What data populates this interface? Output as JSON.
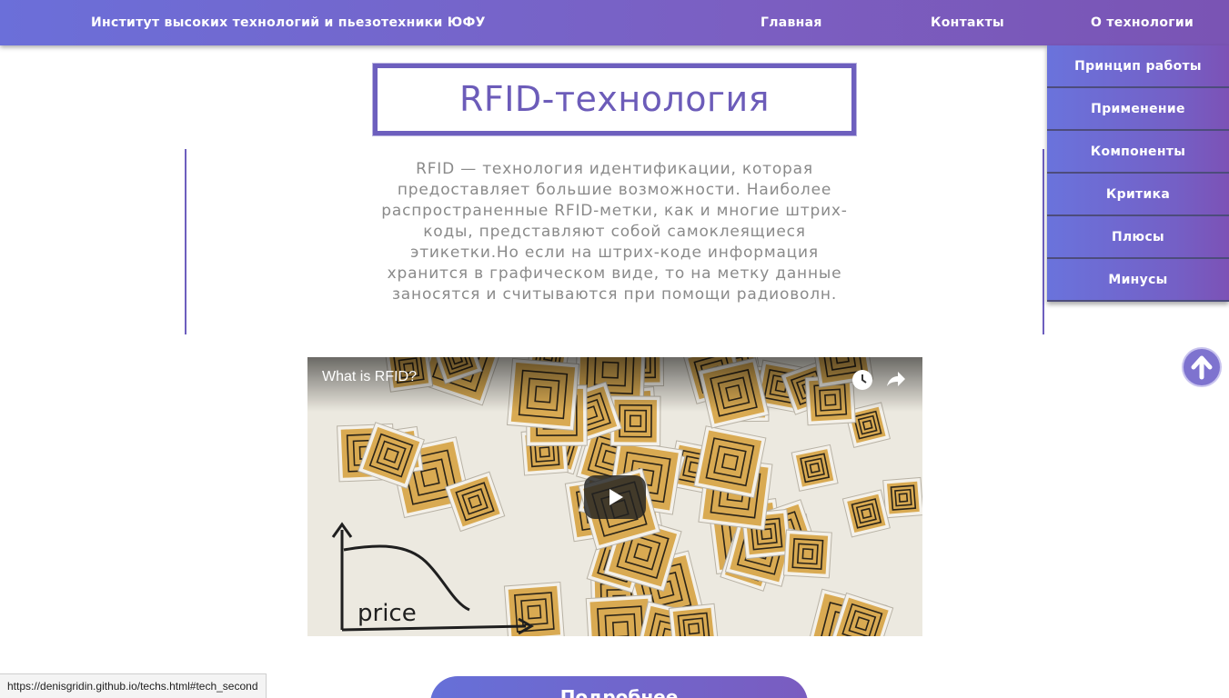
{
  "header": {
    "brand": "Институт высоких технологий и пьезотехники ЮФУ",
    "nav": {
      "home": "Главная",
      "contacts": "Контакты",
      "about": "О технологии"
    }
  },
  "dropdown": {
    "items": [
      {
        "label": "Принцип работы"
      },
      {
        "label": "Применение"
      },
      {
        "label": "Компоненты"
      },
      {
        "label": "Критика"
      },
      {
        "label": "Плюсы"
      },
      {
        "label": "Минусы"
      }
    ]
  },
  "main": {
    "title": "RFID-технология",
    "description": "RFID — технология идентификации, которая предоставляет большие возможности. Наиболее распространенные RFID-метки, как и многие штрих-коды, представляют собой самоклеящиеся этикетки.Но если на штрих-коде информация хранится в графическом виде, то на метку данные заносятся и считываются при помощи радиоволн."
  },
  "video": {
    "title": "What is RFID?",
    "graph_label": "price",
    "icons": [
      "watch-later-icon",
      "share-icon",
      "play-icon"
    ]
  },
  "bottom_button": {
    "label": "Подробнее"
  },
  "status_bar": {
    "url": "https://denisgridin.github.io/techs.html#tech_second"
  },
  "colors": {
    "accent": "#6d5fbe",
    "header_start": "#6b6fd9",
    "header_end": "#7a54b4",
    "text_gray": "#8a8a8a"
  }
}
